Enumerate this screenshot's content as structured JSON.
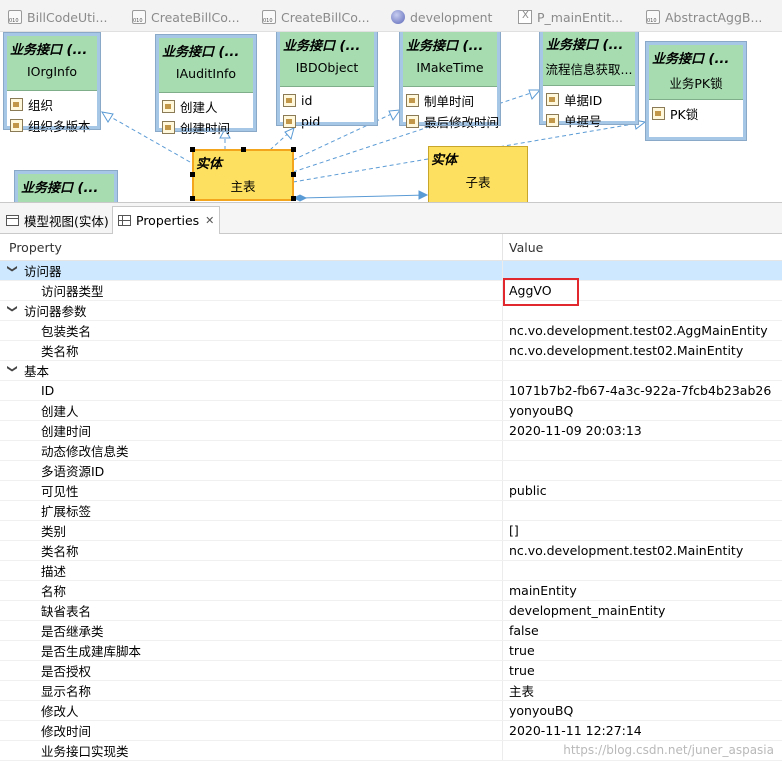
{
  "editor_tabs": [
    {
      "label": "BillCodeUti...",
      "icon": "class-file-icon"
    },
    {
      "label": "CreateBillCo...",
      "icon": "class-file-icon"
    },
    {
      "label": "CreateBillCo...",
      "icon": "class-file-icon"
    },
    {
      "label": "development",
      "icon": "metadata-ball-icon"
    },
    {
      "label": "P_mainEntit...",
      "icon": "xml-file-icon"
    },
    {
      "label": "AbstractAggB...",
      "icon": "class-file-icon"
    }
  ],
  "diagram": {
    "interfaces": [
      {
        "type": "业务接口 (...",
        "name": "IOrgInfo",
        "attrs": [
          "组织",
          "组织多版本"
        ]
      },
      {
        "type": "业务接口 (...",
        "name": "IAuditInfo",
        "attrs": [
          "创建人",
          "创建时间"
        ]
      },
      {
        "type": "业务接口 (...",
        "name": "IBDObject",
        "attrs": [
          "id",
          "pid"
        ]
      },
      {
        "type": "业务接口 (...",
        "name": "IMakeTime",
        "attrs": [
          "制单时间",
          "最后修改时间"
        ]
      },
      {
        "type": "业务接口 (...",
        "name": "流程信息获取...",
        "attrs": [
          "单据ID",
          "单据号"
        ]
      },
      {
        "type": "业务接口 (...",
        "name": "业务PK锁",
        "attrs": [
          "PK锁"
        ]
      },
      {
        "type": "业务接口 (...",
        "name": "",
        "attrs": []
      }
    ],
    "entities": [
      {
        "type": "实体",
        "name": "主表"
      },
      {
        "type": "实体",
        "name": "子表"
      }
    ]
  },
  "view_tabs": [
    {
      "label": "模型视图(实体)",
      "active": false
    },
    {
      "label": "Properties",
      "active": true
    }
  ],
  "properties": {
    "col_property": "Property",
    "col_value": "Value",
    "rows": [
      {
        "kind": "cat",
        "key": "访问器",
        "value": "",
        "selected": true
      },
      {
        "kind": "item",
        "key": "访问器类型",
        "value": "AggVO",
        "highlight": true
      },
      {
        "kind": "cat",
        "key": "访问器参数",
        "value": ""
      },
      {
        "kind": "item",
        "key": "包装类名",
        "value": "nc.vo.development.test02.AggMainEntity"
      },
      {
        "kind": "item",
        "key": "类名称",
        "value": "nc.vo.development.test02.MainEntity"
      },
      {
        "kind": "cat",
        "key": "基本",
        "value": ""
      },
      {
        "kind": "item",
        "key": "ID",
        "value": "1071b7b2-fb67-4a3c-922a-7fcb4b23ab26"
      },
      {
        "kind": "item",
        "key": "创建人",
        "value": "yonyouBQ"
      },
      {
        "kind": "item",
        "key": "创建时间",
        "value": "2020-11-09 20:03:13"
      },
      {
        "kind": "item",
        "key": "动态修改信息类",
        "value": ""
      },
      {
        "kind": "item",
        "key": "多语资源ID",
        "value": ""
      },
      {
        "kind": "item",
        "key": "可见性",
        "value": "public"
      },
      {
        "kind": "item",
        "key": "扩展标签",
        "value": ""
      },
      {
        "kind": "item",
        "key": "类别",
        "value": "[]"
      },
      {
        "kind": "item",
        "key": "类名称",
        "value": "nc.vo.development.test02.MainEntity"
      },
      {
        "kind": "item",
        "key": "描述",
        "value": ""
      },
      {
        "kind": "item",
        "key": "名称",
        "value": "mainEntity"
      },
      {
        "kind": "item",
        "key": "缺省表名",
        "value": "development_mainEntity"
      },
      {
        "kind": "item",
        "key": "是否继承类",
        "value": "false"
      },
      {
        "kind": "item",
        "key": "是否生成建库脚本",
        "value": "true"
      },
      {
        "kind": "item",
        "key": "是否授权",
        "value": "true"
      },
      {
        "kind": "item",
        "key": "显示名称",
        "value": "主表"
      },
      {
        "kind": "item",
        "key": "修改人",
        "value": "yonyouBQ"
      },
      {
        "kind": "item",
        "key": "修改时间",
        "value": "2020-11-11 12:27:14"
      },
      {
        "kind": "item",
        "key": "业务接口实现类",
        "value": ""
      }
    ]
  },
  "watermark": "https://blog.csdn.net/juner_aspasia",
  "colors": {
    "interface_header": "#a7dcb0",
    "interface_border": "#a7c7e6",
    "entity_fill": "#fde05f",
    "selection_row": "#cde8ff",
    "highlight_box": "#e0282e"
  }
}
